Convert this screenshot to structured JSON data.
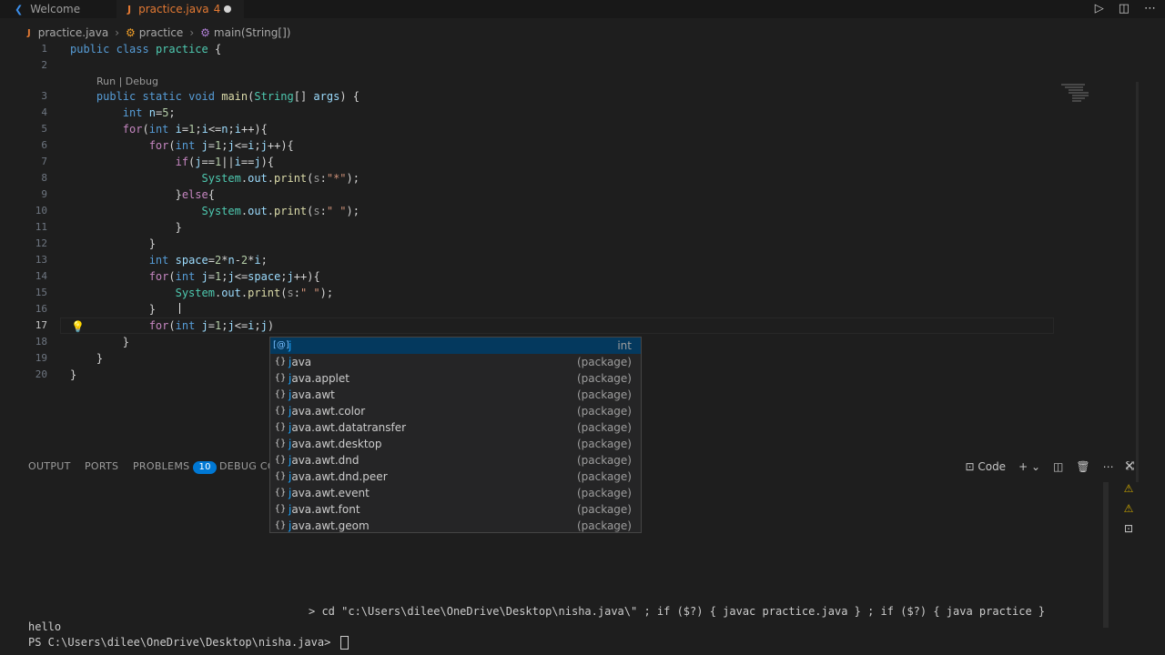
{
  "tabs": [
    {
      "label": "Welcome",
      "icon": "vscode-icon"
    },
    {
      "label": "practice.java",
      "problems": "4",
      "icon": "java-icon",
      "icon_glyph": "J"
    }
  ],
  "breadcrumb": {
    "file": "practice.java",
    "class": "practice",
    "method": "main(String[])"
  },
  "codelens": "Run | Debug",
  "lines": [
    {
      "n": "1",
      "code": "public class practice {"
    },
    {
      "n": "2",
      "code": ""
    },
    {
      "n": "3",
      "code": "    public static void main(String[] args) {"
    },
    {
      "n": "4",
      "code": "        int n=5;"
    },
    {
      "n": "5",
      "code": "        for(int i=1;i<=n;i++){"
    },
    {
      "n": "6",
      "code": "            for(int j=1;j<=i;j++){"
    },
    {
      "n": "7",
      "code": "                if(j==1||i==j){"
    },
    {
      "n": "8",
      "code": "                    System.out.print(s:\"*\");"
    },
    {
      "n": "9",
      "code": "                }else{"
    },
    {
      "n": "10",
      "code": "                    System.out.print(s:\" \");"
    },
    {
      "n": "11",
      "code": "                }"
    },
    {
      "n": "12",
      "code": "            }"
    },
    {
      "n": "13",
      "code": "            int space=2*n-2*i;"
    },
    {
      "n": "14",
      "code": "            for(int j=1;j<=space;j++){"
    },
    {
      "n": "15",
      "code": "                System.out.print(s:\" \");"
    },
    {
      "n": "16",
      "code": "            }"
    },
    {
      "n": "17",
      "code": "            for(int j=1;j<=i;j)"
    },
    {
      "n": "18",
      "code": "        }"
    },
    {
      "n": "19",
      "code": "    }"
    },
    {
      "n": "20",
      "code": "}"
    }
  ],
  "suggestions": [
    {
      "label": "j",
      "detail": "int",
      "icon": "variable-icon",
      "glyph": "[@]"
    },
    {
      "label": "java",
      "detail": "(package)",
      "icon": "package-icon",
      "glyph": "{}"
    },
    {
      "label": "java.applet",
      "detail": "(package)",
      "icon": "package-icon",
      "glyph": "{}"
    },
    {
      "label": "java.awt",
      "detail": "(package)",
      "icon": "package-icon",
      "glyph": "{}"
    },
    {
      "label": "java.awt.color",
      "detail": "(package)",
      "icon": "package-icon",
      "glyph": "{}"
    },
    {
      "label": "java.awt.datatransfer",
      "detail": "(package)",
      "icon": "package-icon",
      "glyph": "{}"
    },
    {
      "label": "java.awt.desktop",
      "detail": "(package)",
      "icon": "package-icon",
      "glyph": "{}"
    },
    {
      "label": "java.awt.dnd",
      "detail": "(package)",
      "icon": "package-icon",
      "glyph": "{}"
    },
    {
      "label": "java.awt.dnd.peer",
      "detail": "(package)",
      "icon": "package-icon",
      "glyph": "{}"
    },
    {
      "label": "java.awt.event",
      "detail": "(package)",
      "icon": "package-icon",
      "glyph": "{}"
    },
    {
      "label": "java.awt.font",
      "detail": "(package)",
      "icon": "package-icon",
      "glyph": "{}"
    },
    {
      "label": "java.awt.geom",
      "detail": "(package)",
      "icon": "package-icon",
      "glyph": "{}"
    }
  ],
  "panel": {
    "tabs": [
      {
        "label": "OUTPUT"
      },
      {
        "label": "PORTS"
      },
      {
        "label": "PROBLEMS",
        "badge": "10"
      },
      {
        "label": "DEBUG CON"
      }
    ],
    "terminal_profile": "Code"
  },
  "terminal": {
    "command": "> cd \"c:\\Users\\dilee\\OneDrive\\Desktop\\nisha.java\\\" ; if ($?) { javac practice.java } ; if ($?) { java practice }",
    "output": "hello",
    "prompt": "PS C:\\Users\\dilee\\OneDrive\\Desktop\\nisha.java> "
  }
}
